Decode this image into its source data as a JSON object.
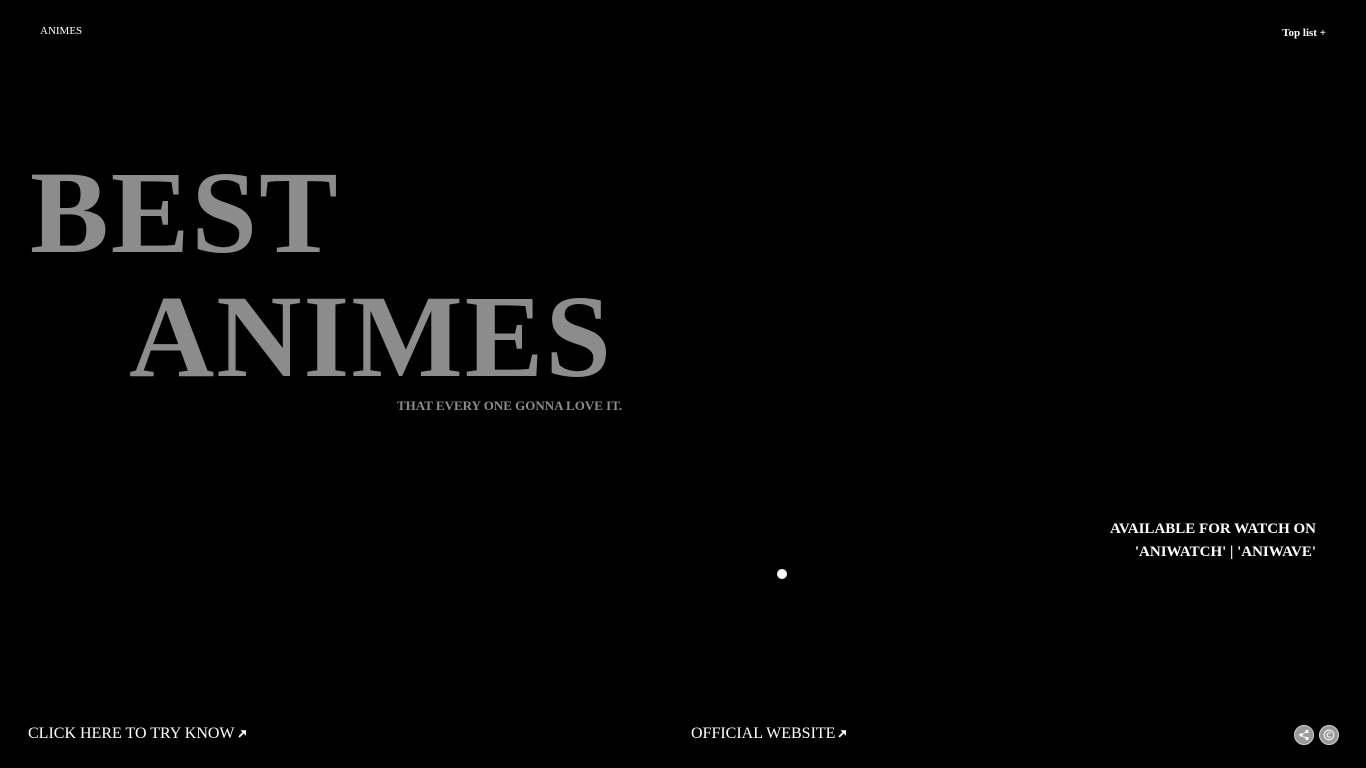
{
  "header": {
    "brand": "ANIMES",
    "top_list_label": "Top list +"
  },
  "hero": {
    "line1": "BEST",
    "line2": "ANIMES",
    "tagline": "THAT EVERY ONE GONNA LOVE IT."
  },
  "availability": {
    "line1": "AVAILABLE FOR WATCH ON",
    "line2": "'ANIWATCH' | 'ANIWAVE'"
  },
  "footer": {
    "try_label": "CLICK HERE TO TRY KNOW",
    "official_label": "OFFICIAL WEBSITE",
    "icons": [
      "share-icon",
      "copyright-icon"
    ]
  },
  "colors": {
    "background": "#000000",
    "hero_text": "#8c8c8c",
    "text": "#ffffff"
  }
}
